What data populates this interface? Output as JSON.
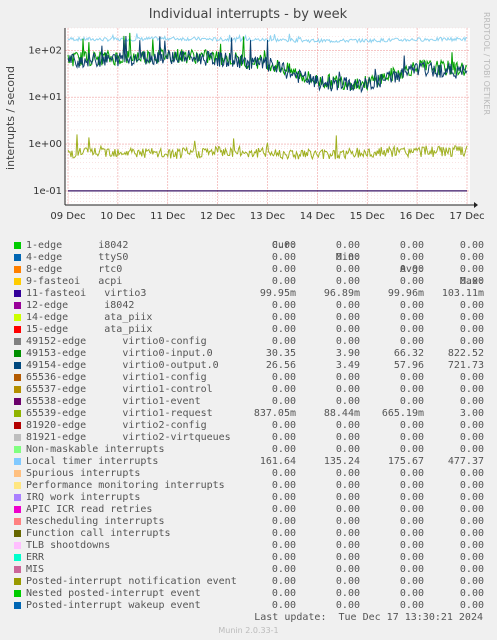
{
  "chart_data": {
    "type": "line",
    "title": "Individual interrupts - by week",
    "ylabel": "interrupts / second",
    "yscale": "log",
    "ylim": [
      0.05,
      300
    ],
    "yticks": [
      "1e+02",
      "1e+01",
      "1e+00",
      "1e-01"
    ],
    "xticks": [
      "09 Dec",
      "10 Dec",
      "11 Dec",
      "12 Dec",
      "13 Dec",
      "14 Dec",
      "15 Dec",
      "16 Dec",
      "17 Dec"
    ],
    "grid": true,
    "series": [
      {
        "name": "Local timer interrupts",
        "color": "#8fd3f0",
        "x": [
          "09 Dec",
          "10 Dec",
          "11 Dec",
          "12 Dec",
          "13 Dec",
          "14 Dec",
          "15 Dec",
          "16 Dec",
          "17 Dec"
        ],
        "values": [
          175,
          170,
          180,
          172,
          168,
          160,
          162,
          170,
          175
        ]
      },
      {
        "name": "virtio0-input.0",
        "color": "#00a000",
        "x": [
          "09 Dec",
          "10 Dec",
          "11 Dec",
          "12 Dec",
          "13 Dec",
          "14 Dec",
          "15 Dec",
          "16 Dec",
          "17 Dec"
        ],
        "values": [
          65,
          70,
          80,
          70,
          55,
          22,
          20,
          45,
          40
        ]
      },
      {
        "name": "virtio0-output.0",
        "color": "#0d3f6e",
        "x": [
          "09 Dec",
          "10 Dec",
          "11 Dec",
          "12 Dec",
          "13 Dec",
          "14 Dec",
          "15 Dec",
          "16 Dec",
          "17 Dec"
        ],
        "values": [
          60,
          65,
          75,
          65,
          50,
          20,
          18,
          40,
          35
        ]
      },
      {
        "name": "virtio1-request",
        "color": "#a0b020",
        "x": [
          "09 Dec",
          "10 Dec",
          "11 Dec",
          "12 Dec",
          "13 Dec",
          "14 Dec",
          "15 Dec",
          "16 Dec",
          "17 Dec"
        ],
        "values": [
          0.65,
          0.7,
          0.6,
          0.7,
          0.65,
          0.6,
          0.65,
          0.7,
          0.7
        ]
      },
      {
        "name": "virtio3",
        "color": "#3a1466",
        "x": [
          "09 Dec",
          "10 Dec",
          "11 Dec",
          "12 Dec",
          "13 Dec",
          "14 Dec",
          "15 Dec",
          "16 Dec",
          "17 Dec"
        ],
        "values": [
          0.1,
          0.1,
          0.1,
          0.1,
          0.1,
          0.1,
          0.1,
          0.1,
          0.1
        ]
      }
    ]
  },
  "side_label": "RRDTOOL / TOBI OETIKER",
  "legend": {
    "headers": [
      "Cur:",
      "Min:",
      "Avg:",
      "Max:"
    ],
    "rows": [
      {
        "color": "#00cc00",
        "name": "1-edge      i8042",
        "cur": "0.00",
        "min": "0.00",
        "avg": "0.00",
        "max": "0.00"
      },
      {
        "color": "#0066b3",
        "name": "4-edge      ttyS0",
        "cur": "0.00",
        "min": "0.00",
        "avg": "0.00",
        "max": "0.00"
      },
      {
        "color": "#ff8000",
        "name": "8-edge      rtc0",
        "cur": "0.00",
        "min": "0.00",
        "avg": "0.00",
        "max": "0.00"
      },
      {
        "color": "#ffcc00",
        "name": "9-fasteoi   acpi",
        "cur": "0.00",
        "min": "0.00",
        "avg": "0.00",
        "max": "0.00"
      },
      {
        "color": "#330099",
        "name": "11-fasteoi   virtio3",
        "cur": "99.95m",
        "min": "96.89m",
        "avg": "99.96m",
        "max": "103.11m"
      },
      {
        "color": "#990099",
        "name": "12-edge      i8042",
        "cur": "0.00",
        "min": "0.00",
        "avg": "0.00",
        "max": "0.00"
      },
      {
        "color": "#ccff00",
        "name": "14-edge      ata_piix",
        "cur": "0.00",
        "min": "0.00",
        "avg": "0.00",
        "max": "0.00"
      },
      {
        "color": "#ff0000",
        "name": "15-edge      ata_piix",
        "cur": "0.00",
        "min": "0.00",
        "avg": "0.00",
        "max": "0.00"
      },
      {
        "color": "#808080",
        "name": "49152-edge      virtio0-config",
        "cur": "0.00",
        "min": "0.00",
        "avg": "0.00",
        "max": "0.00"
      },
      {
        "color": "#008f00",
        "name": "49153-edge      virtio0-input.0",
        "cur": "30.35",
        "min": "3.90",
        "avg": "66.32",
        "max": "822.52"
      },
      {
        "color": "#00487d",
        "name": "49154-edge      virtio0-output.0",
        "cur": "26.56",
        "min": "3.49",
        "avg": "57.96",
        "max": "721.73"
      },
      {
        "color": "#b35a00",
        "name": "65536-edge      virtio1-config",
        "cur": "0.00",
        "min": "0.00",
        "avg": "0.00",
        "max": "0.00"
      },
      {
        "color": "#b38f00",
        "name": "65537-edge      virtio1-control",
        "cur": "0.00",
        "min": "0.00",
        "avg": "0.00",
        "max": "0.00"
      },
      {
        "color": "#6b006b",
        "name": "65538-edge      virtio1-event",
        "cur": "0.00",
        "min": "0.00",
        "avg": "0.00",
        "max": "0.00"
      },
      {
        "color": "#8fb300",
        "name": "65539-edge      virtio1-request",
        "cur": "837.05m",
        "min": "88.44m",
        "avg": "665.19m",
        "max": "3.00"
      },
      {
        "color": "#b30000",
        "name": "81920-edge      virtio2-config",
        "cur": "0.00",
        "min": "0.00",
        "avg": "0.00",
        "max": "0.00"
      },
      {
        "color": "#bebebe",
        "name": "81921-edge      virtio2-virtqueues",
        "cur": "0.00",
        "min": "0.00",
        "avg": "0.00",
        "max": "0.00"
      },
      {
        "color": "#80ff80",
        "name": "Non-maskable interrupts",
        "cur": "0.00",
        "min": "0.00",
        "avg": "0.00",
        "max": "0.00"
      },
      {
        "color": "#80c9ff",
        "name": "Local timer interrupts",
        "cur": "161.64",
        "min": "135.24",
        "avg": "175.67",
        "max": "477.37"
      },
      {
        "color": "#ffc080",
        "name": "Spurious interrupts",
        "cur": "0.00",
        "min": "0.00",
        "avg": "0.00",
        "max": "0.00"
      },
      {
        "color": "#ffe680",
        "name": "Performance monitoring interrupts",
        "cur": "0.00",
        "min": "0.00",
        "avg": "0.00",
        "max": "0.00"
      },
      {
        "color": "#aa80ff",
        "name": "IRQ work interrupts",
        "cur": "0.00",
        "min": "0.00",
        "avg": "0.00",
        "max": "0.00"
      },
      {
        "color": "#ee00cc",
        "name": "APIC ICR read retries",
        "cur": "0.00",
        "min": "0.00",
        "avg": "0.00",
        "max": "0.00"
      },
      {
        "color": "#ff8080",
        "name": "Rescheduling interrupts",
        "cur": "0.00",
        "min": "0.00",
        "avg": "0.00",
        "max": "0.00"
      },
      {
        "color": "#666600",
        "name": "Function call interrupts",
        "cur": "0.00",
        "min": "0.00",
        "avg": "0.00",
        "max": "0.00"
      },
      {
        "color": "#ffbfff",
        "name": "TLB shootdowns",
        "cur": "0.00",
        "min": "0.00",
        "avg": "0.00",
        "max": "0.00"
      },
      {
        "color": "#00ffcc",
        "name": "ERR",
        "cur": "0.00",
        "min": "0.00",
        "avg": "0.00",
        "max": "0.00"
      },
      {
        "color": "#cc6699",
        "name": "MIS",
        "cur": "0.00",
        "min": "0.00",
        "avg": "0.00",
        "max": "0.00"
      },
      {
        "color": "#999900",
        "name": "Posted-interrupt notification event",
        "cur": "0.00",
        "min": "0.00",
        "avg": "0.00",
        "max": "0.00"
      },
      {
        "color": "#00cc00",
        "name": "Nested posted-interrupt event",
        "cur": "0.00",
        "min": "0.00",
        "avg": "0.00",
        "max": "0.00"
      },
      {
        "color": "#0066b3",
        "name": "Posted-interrupt wakeup event",
        "cur": "0.00",
        "min": "0.00",
        "avg": "0.00",
        "max": "0.00"
      }
    ]
  },
  "last_update": "Last update:  Tue Dec 17 13:30:21 2024",
  "footer": "Munin 2.0.33-1"
}
